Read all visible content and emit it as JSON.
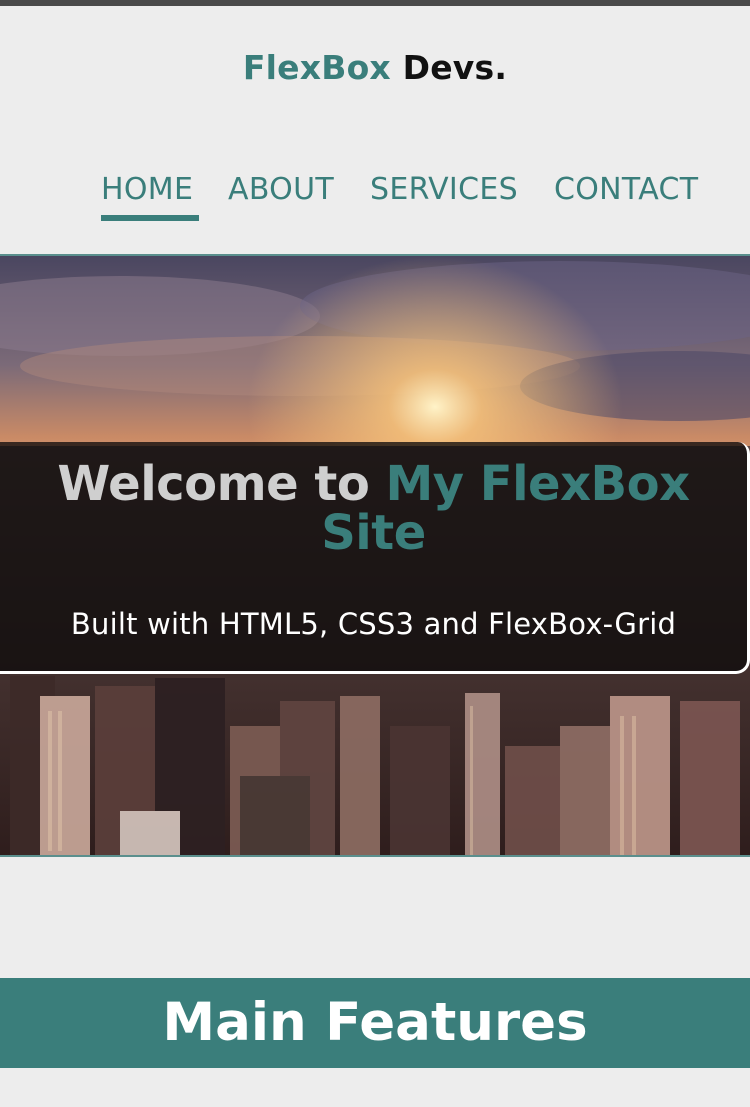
{
  "header": {
    "brand_accent": "FlexBox",
    "brand_rest": "Devs."
  },
  "nav": {
    "items": [
      {
        "label": "HOME",
        "active": true
      },
      {
        "label": "ABOUT",
        "active": false
      },
      {
        "label": "SERVICES",
        "active": false
      },
      {
        "label": "CONTACT",
        "active": false
      }
    ]
  },
  "hero": {
    "title_lead": "Welcome to",
    "title_accent": "My FlexBox Site",
    "subtitle": "Built with HTML5, CSS3 and FlexBox-Grid"
  },
  "features": {
    "heading": "Main Features"
  },
  "colors": {
    "accent": "#3a7e7b",
    "background": "#ededed",
    "text_dark": "#111111"
  }
}
